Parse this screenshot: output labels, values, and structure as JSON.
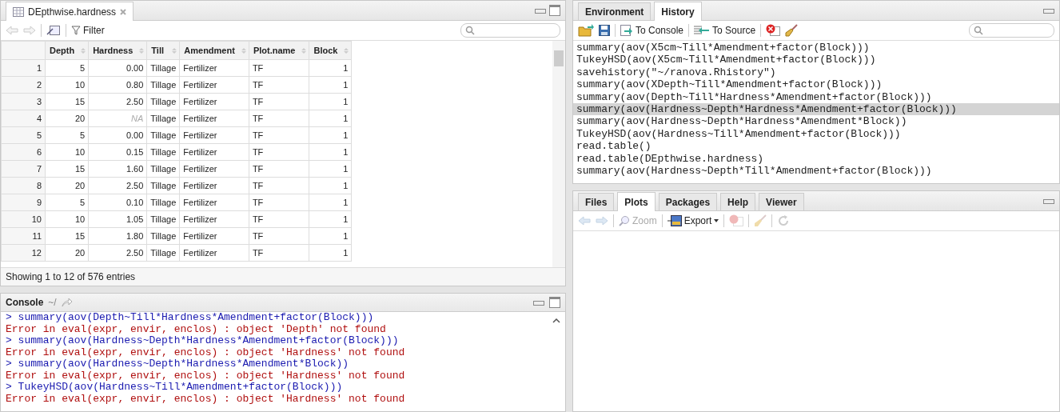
{
  "source_pane": {
    "tab": {
      "title": "DEpthwise.hardness"
    },
    "filter_label": "Filter",
    "table": {
      "columns": [
        "Depth",
        "Hardness",
        "Till",
        "Amendment",
        "Plot.name",
        "Block"
      ],
      "rows": [
        {
          "num": "1",
          "cells": [
            "5",
            "0.00",
            "Tillage",
            "Fertilizer",
            "TF",
            "1"
          ],
          "hardness_missing": false
        },
        {
          "num": "2",
          "cells": [
            "10",
            "0.80",
            "Tillage",
            "Fertilizer",
            "TF",
            "1"
          ],
          "hardness_missing": false
        },
        {
          "num": "3",
          "cells": [
            "15",
            "2.50",
            "Tillage",
            "Fertilizer",
            "TF",
            "1"
          ],
          "hardness_missing": false
        },
        {
          "num": "4",
          "cells": [
            "20",
            "NA",
            "Tillage",
            "Fertilizer",
            "TF",
            "1"
          ],
          "hardness_missing": true
        },
        {
          "num": "5",
          "cells": [
            "5",
            "0.00",
            "Tillage",
            "Fertilizer",
            "TF",
            "1"
          ],
          "hardness_missing": false
        },
        {
          "num": "6",
          "cells": [
            "10",
            "0.15",
            "Tillage",
            "Fertilizer",
            "TF",
            "1"
          ],
          "hardness_missing": false
        },
        {
          "num": "7",
          "cells": [
            "15",
            "1.60",
            "Tillage",
            "Fertilizer",
            "TF",
            "1"
          ],
          "hardness_missing": false
        },
        {
          "num": "8",
          "cells": [
            "20",
            "2.50",
            "Tillage",
            "Fertilizer",
            "TF",
            "1"
          ],
          "hardness_missing": false
        },
        {
          "num": "9",
          "cells": [
            "5",
            "0.10",
            "Tillage",
            "Fertilizer",
            "TF",
            "1"
          ],
          "hardness_missing": false
        },
        {
          "num": "10",
          "cells": [
            "10",
            "1.05",
            "Tillage",
            "Fertilizer",
            "TF",
            "1"
          ],
          "hardness_missing": false
        },
        {
          "num": "11",
          "cells": [
            "15",
            "1.80",
            "Tillage",
            "Fertilizer",
            "TF",
            "1"
          ],
          "hardness_missing": false
        },
        {
          "num": "12",
          "cells": [
            "20",
            "2.50",
            "Tillage",
            "Fertilizer",
            "TF",
            "1"
          ],
          "hardness_missing": false
        }
      ]
    },
    "status": "Showing 1 to 12 of 576 entries"
  },
  "console": {
    "title": "Console",
    "path": "~/",
    "lines": [
      {
        "kind": "command",
        "text": "> summary(aov(Depth~Till*Hardness*Amendment+factor(Block)))"
      },
      {
        "kind": "error",
        "text": "Error in eval(expr, envir, enclos) : object 'Depth' not found"
      },
      {
        "kind": "command",
        "text": "> summary(aov(Hardness~Depth*Hardness*Amendment+factor(Block)))"
      },
      {
        "kind": "error",
        "text": "Error in eval(expr, envir, enclos) : object 'Hardness' not found"
      },
      {
        "kind": "command",
        "text": "> summary(aov(Hardness~Depth*Hardness*Amendment*Block))"
      },
      {
        "kind": "error",
        "text": "Error in eval(expr, envir, enclos) : object 'Hardness' not found"
      },
      {
        "kind": "command",
        "text": "> TukeyHSD(aov(Hardness~Till*Amendment+factor(Block)))"
      },
      {
        "kind": "error",
        "text": "Error in eval(expr, envir, enclos) : object 'Hardness' not found"
      }
    ]
  },
  "history_pane": {
    "tabs": [
      {
        "label": "Environment",
        "selected": false
      },
      {
        "label": "History",
        "selected": true
      }
    ],
    "to_console": "To Console",
    "to_source": "To Source",
    "lines": [
      {
        "text": "summary(aov(X5cm~Till*Amendment+factor(Block)))",
        "selected": false
      },
      {
        "text": "TukeyHSD(aov(X5cm~Till*Amendment+factor(Block)))",
        "selected": false
      },
      {
        "text": "savehistory(\"~/ranova.Rhistory\")",
        "selected": false
      },
      {
        "text": "summary(aov(XDepth~Till*Amendment+factor(Block)))",
        "selected": false
      },
      {
        "text": "summary(aov(Depth~Till*Hardness*Amendment+factor(Block)))",
        "selected": false
      },
      {
        "text": "summary(aov(Hardness~Depth*Hardness*Amendment+factor(Block)))",
        "selected": true
      },
      {
        "text": "summary(aov(Hardness~Depth*Hardness*Amendment*Block))",
        "selected": false
      },
      {
        "text": "TukeyHSD(aov(Hardness~Till*Amendment+factor(Block)))",
        "selected": false
      },
      {
        "text": "read.table()",
        "selected": false
      },
      {
        "text": "read.table(DEpthwise.hardness)",
        "selected": false
      },
      {
        "text": "summary(aov(Hardness~Depth*Till*Amendment+factor(Block)))",
        "selected": false
      }
    ]
  },
  "plots_pane": {
    "tabs": [
      {
        "label": "Files",
        "selected": false
      },
      {
        "label": "Plots",
        "selected": true
      },
      {
        "label": "Packages",
        "selected": false
      },
      {
        "label": "Help",
        "selected": false
      },
      {
        "label": "Viewer",
        "selected": false
      }
    ],
    "zoom": {
      "label": "Zoom",
      "disabled": true
    },
    "export": {
      "label": "Export",
      "disabled": false
    }
  }
}
